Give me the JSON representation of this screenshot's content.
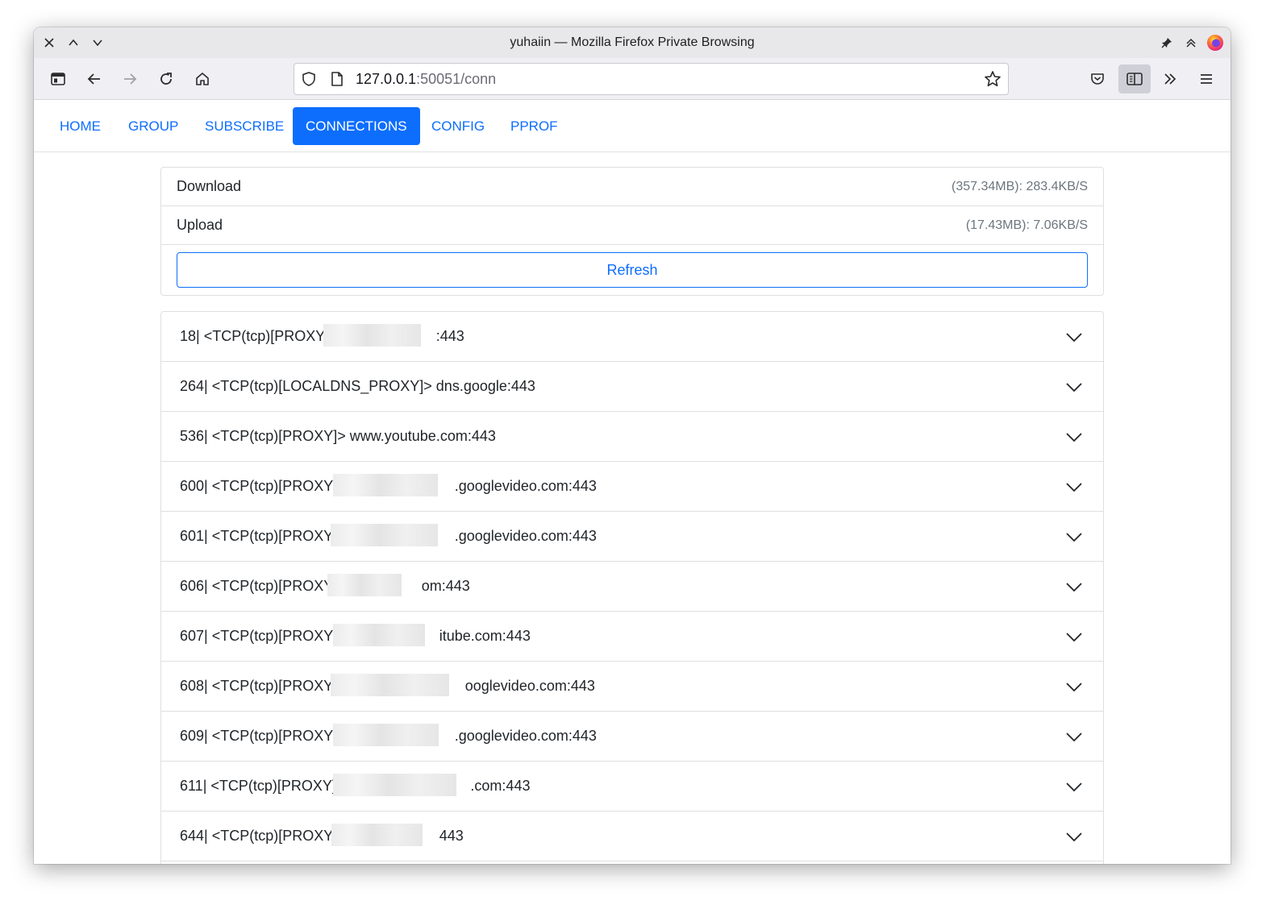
{
  "window": {
    "title": "yuhaiin — Mozilla Firefox Private Browsing"
  },
  "url": {
    "host": "127.0.0.1",
    "rest": ":50051/conn"
  },
  "tabs": [
    {
      "label": "HOME",
      "active": false
    },
    {
      "label": "GROUP",
      "active": false
    },
    {
      "label": "SUBSCRIBE",
      "active": false
    },
    {
      "label": "CONNECTIONS",
      "active": true
    },
    {
      "label": "CONFIG",
      "active": false
    },
    {
      "label": "PPROF",
      "active": false
    }
  ],
  "stats": {
    "download": {
      "label": "Download",
      "value": "(357.34MB): 283.4KB/S"
    },
    "upload": {
      "label": "Upload",
      "value": "(17.43MB): 7.06KB/S"
    },
    "refresh_label": "Refresh"
  },
  "connections": [
    {
      "prefix": "18| <TCP(tcp)[PROXY]>",
      "suffix": ":443"
    },
    {
      "prefix": "264| <TCP(tcp)[LOCALDNS_PROXY]> dns.google:443",
      "suffix": ""
    },
    {
      "prefix": "536| <TCP(tcp)[PROXY]> www.youtube.com:443",
      "suffix": ""
    },
    {
      "prefix": "600| <TCP(tcp)[PROXY]>",
      "suffix": ".googlevideo.com:443"
    },
    {
      "prefix": "601| <TCP(tcp)[PROXY]>",
      "suffix": ".googlevideo.com:443"
    },
    {
      "prefix": "606| <TCP(tcp)[PROXY]>",
      "suffix": "om:443"
    },
    {
      "prefix": "607| <TCP(tcp)[PROXY]>",
      "suffix": "itube.com:443"
    },
    {
      "prefix": "608| <TCP(tcp)[PROXY]>",
      "suffix": "ooglevideo.com:443"
    },
    {
      "prefix": "609| <TCP(tcp)[PROXY]>",
      "suffix": ".googlevideo.com:443"
    },
    {
      "prefix": "611| <TCP(tcp)[PROXY]>",
      "suffix": ".com:443"
    },
    {
      "prefix": "644| <TCP(tcp)[PROXY]>",
      "suffix": "443"
    }
  ],
  "colors": {
    "primary": "#0d6efd",
    "firefox_accent": "#ff7139"
  }
}
